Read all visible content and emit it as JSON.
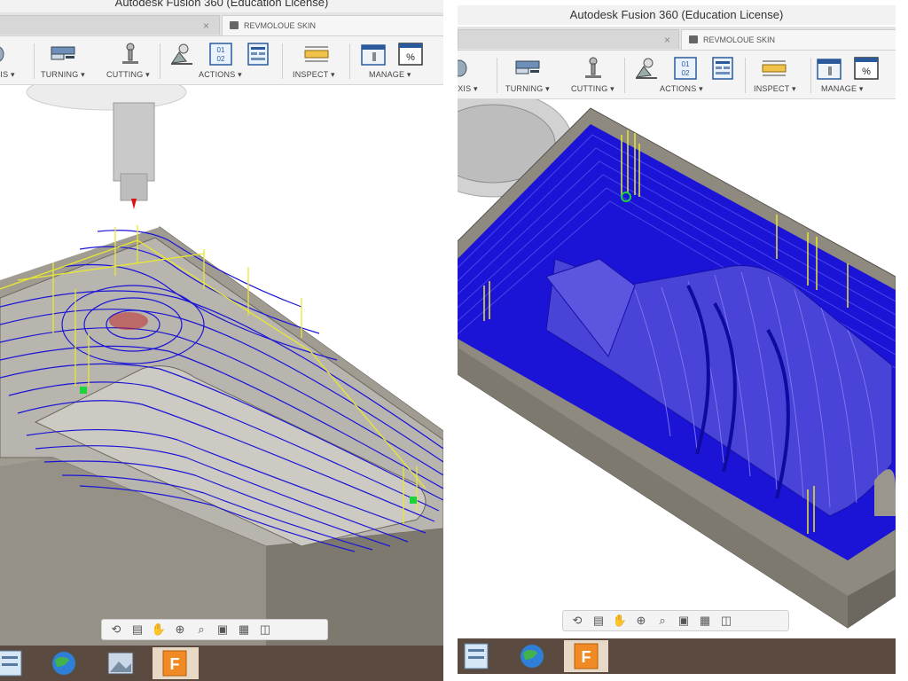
{
  "left": {
    "window_title": "Autodesk Fusion 360 (Education License)",
    "inactive_tab_label": "",
    "active_tab_label": "REVMOLOUE SKIN",
    "toolbar": {
      "axis_label": "AXIS ▾",
      "turning_label": "TURNING ▾",
      "cutting_label": "CUTTING ▾",
      "actions_label": "ACTIONS ▾",
      "inspect_label": "INSPECT ▾",
      "manage_label": "MANAGE ▾",
      "nc_icon_text": "01\n02",
      "percent_icon_text": "%"
    }
  },
  "right": {
    "window_title": "Autodesk Fusion 360 (Education License)",
    "inactive_tab_label": "",
    "active_tab_label": "REVMOLOUE SKIN",
    "toolbar": {
      "axis_label": "AXIS ▾",
      "turning_label": "TURNING ▾",
      "cutting_label": "CUTTING ▾",
      "actions_label": "ACTIONS ▾",
      "inspect_label": "INSPECT ▾",
      "manage_label": "MANAGE ▾",
      "nc_icon_text": "01\n02",
      "percent_icon_text": "%"
    }
  },
  "navbar_icons": [
    "orbit-icon",
    "look-at-icon",
    "pan-icon",
    "zoom-window-icon",
    "zoom-icon",
    "display-settings-icon",
    "grid-icon",
    "viewports-icon"
  ],
  "taskbar_icons": [
    "file-icon",
    "globe-icon",
    "image-icon",
    "fusion-icon"
  ],
  "fusion_letter": "F",
  "colors": {
    "toolpath_blue": "#1b14d6",
    "toolpath_yellow": "#e8e830",
    "stock_gray": "#8f8a80",
    "taskbar_brown": "#5b4a3f",
    "fusion_orange": "#f08a24"
  }
}
